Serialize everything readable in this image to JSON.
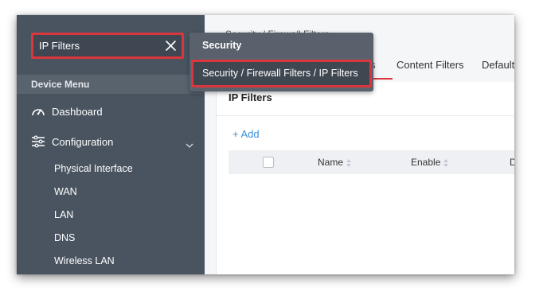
{
  "search": {
    "value": "IP Filters"
  },
  "sidebar": {
    "menu_header": "Device Menu",
    "items": [
      {
        "label": "Dashboard",
        "icon": "dashboard-gauge-icon"
      },
      {
        "label": "Configuration",
        "icon": "sliders-icon",
        "expanded": true
      }
    ],
    "subitems": [
      "Physical Interface",
      "WAN",
      "LAN",
      "DNS",
      "Wireless LAN"
    ]
  },
  "dropdown": {
    "group": "Security",
    "result": "Security / Firewall Filters / IP Filters"
  },
  "main": {
    "breadcrumb": "Security / Firewall Filters",
    "tabs": [
      {
        "label": "s",
        "active": true
      },
      {
        "label": "Content Filters",
        "active": false
      },
      {
        "label": "Default",
        "active": false
      }
    ],
    "card_title": "IP Filters",
    "add_label": "+ Add",
    "columns": [
      "Name",
      "Enable",
      "D"
    ]
  },
  "colors": {
    "highlight": "#d9363e",
    "sidebar": "#4a5460",
    "link": "#3b8fd9"
  }
}
